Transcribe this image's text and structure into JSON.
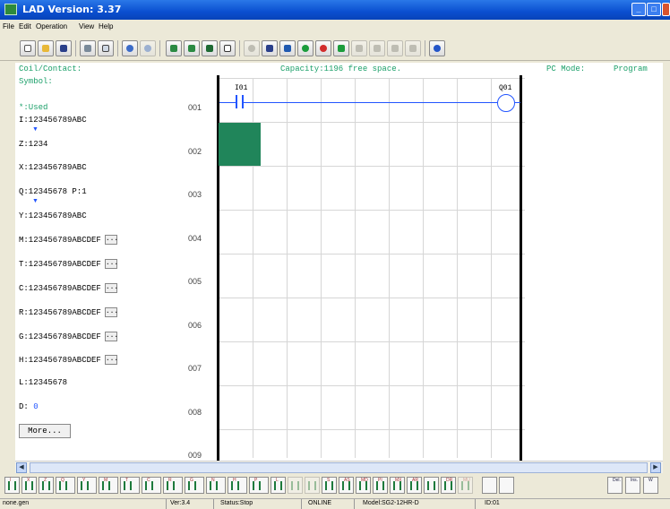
{
  "window": {
    "title": "LAD Version: 3.37"
  },
  "menu": [
    "File",
    "Edit",
    "Operation",
    "View",
    "Help"
  ],
  "panel": {
    "coil_contact_label": "Coil/Contact:",
    "symbol_label": "Symbol:",
    "capacity_text": "Capacity:1196 free space.",
    "pc_mode_label": "PC Mode:",
    "pc_mode_value": "Program",
    "used_label": "*:Used",
    "rows": [
      "I:123456789ABC",
      "Z:1234",
      "X:123456789ABC",
      "Q:12345678 P:1",
      "Y:123456789ABC",
      "M:123456789ABCDEF",
      "T:123456789ABCDEF",
      "C:123456789ABCDEF",
      "R:123456789ABCDEF",
      "G:123456789ABCDEF",
      "H:123456789ABCDEF",
      "L:12345678",
      "D:"
    ],
    "d_value": "0",
    "dots_label": "...",
    "more_button": "More..."
  },
  "ladder": {
    "line_numbers": [
      "001",
      "002",
      "003",
      "004",
      "005",
      "006",
      "007",
      "008",
      "009"
    ],
    "contact_label": "I01",
    "coil_label": "Q01"
  },
  "status": {
    "file": "none.gen",
    "version": "Ver:3.4",
    "state": "Status:Stop",
    "connection": "ONLINE",
    "model": "Model:SG2-12HR-D",
    "id": "ID:01"
  },
  "palette_letters": [
    "I",
    "X",
    "Z",
    "Q",
    "Y",
    "M",
    "T",
    "C",
    "R",
    "G",
    "N",
    "H",
    "P",
    "L",
    "S",
    "AS",
    "MD",
    "PI",
    "MX",
    "AR",
    "DR",
    "MU"
  ],
  "palette_right": [
    "Del.",
    "Ins.",
    "W"
  ]
}
